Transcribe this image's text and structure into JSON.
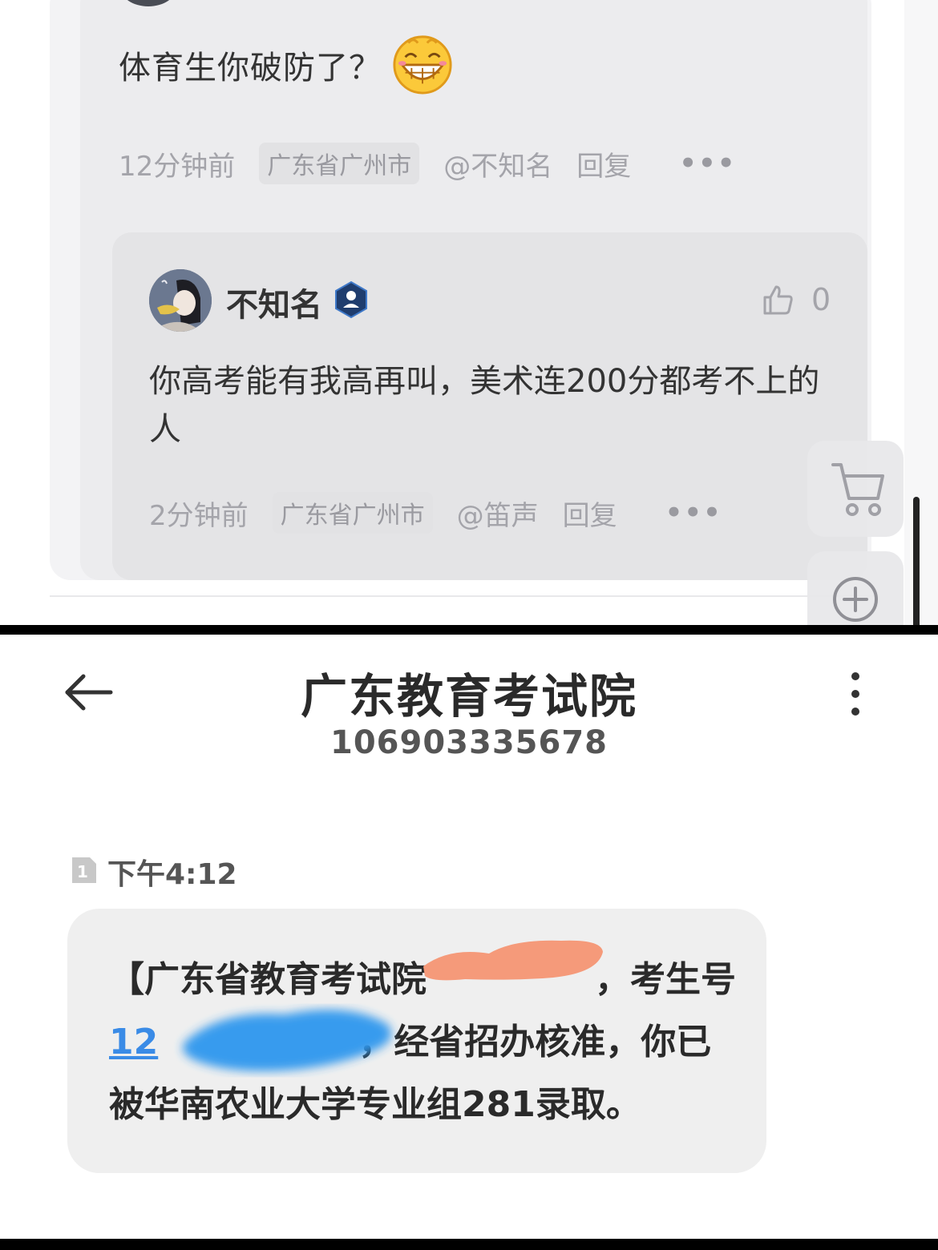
{
  "comment": {
    "text": "体育生你破防了？",
    "time": "12分钟前",
    "location": "广东省广州市",
    "mention": "@不知名",
    "reply_label": "回复",
    "more": "•••"
  },
  "reply": {
    "username": "不知名",
    "like_count": "0",
    "text": "你高考能有我高再叫，美术连200分都考不上的人",
    "time": "2分钟前",
    "location": "广东省广州市",
    "mention": "@笛声",
    "reply_label": "回复",
    "more": "•••"
  },
  "floating_buttons": {
    "cart_icon": "shopping-cart-icon",
    "plus_icon": "plus-circle-icon"
  },
  "sms": {
    "sender": "广东教育考试院",
    "number": "106903335678",
    "sim_label": "1",
    "time": "下午4:12",
    "message": {
      "part1": "【广东省教育考试院",
      "part2": "，考生号",
      "number_prefix": "12",
      "part3": "，经省招办核准，你已被华南农业大学专业组281录取。"
    }
  },
  "colors": {
    "link": "#3a8be6",
    "redact_orange": "#f59a7a",
    "redact_blue": "#2f97ee"
  }
}
